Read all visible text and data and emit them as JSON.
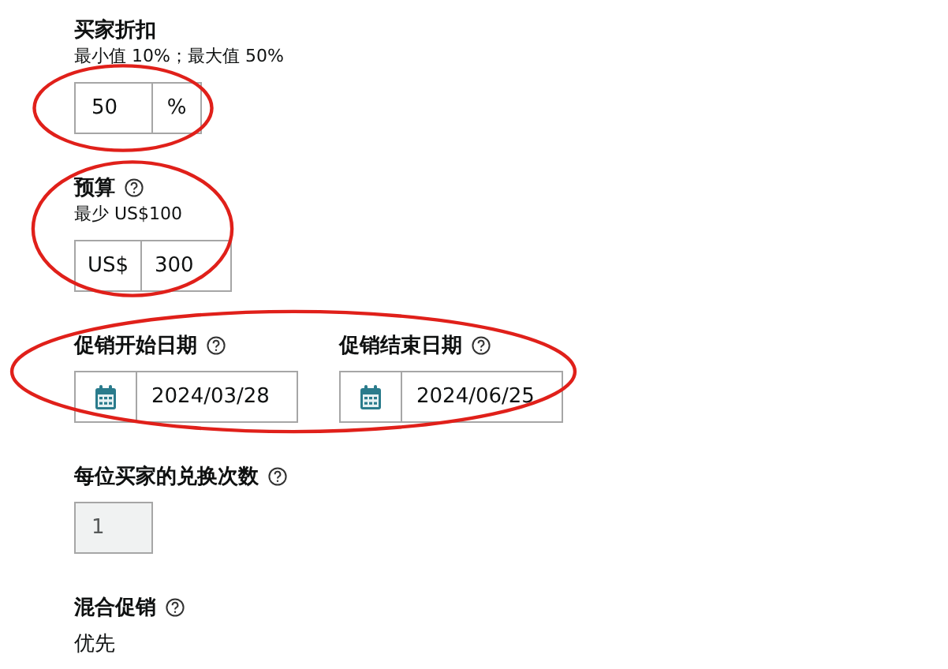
{
  "fields": [
    {
      "kind": "suffix",
      "label": "买家折扣",
      "hint": "最小值 10%；最大值 50%",
      "value": "50",
      "unit": "%",
      "circled": true
    },
    {
      "kind": "prefix",
      "label": "预算",
      "help": true,
      "hint": "最少 US$100",
      "value": "300",
      "unit": "US$",
      "circled": true
    },
    {
      "kind": "dates",
      "circled": true,
      "items": [
        {
          "label": "促销开始日期",
          "help": true,
          "value": "2024/03/28"
        },
        {
          "label": "促销结束日期",
          "help": true,
          "value": "2024/06/25"
        }
      ]
    },
    {
      "kind": "readonly",
      "label": "每位买家的兑换次数",
      "help": true,
      "value": "1",
      "disabled": true
    },
    {
      "kind": "text",
      "label": "混合促销",
      "help": true,
      "value": "优先"
    }
  ]
}
